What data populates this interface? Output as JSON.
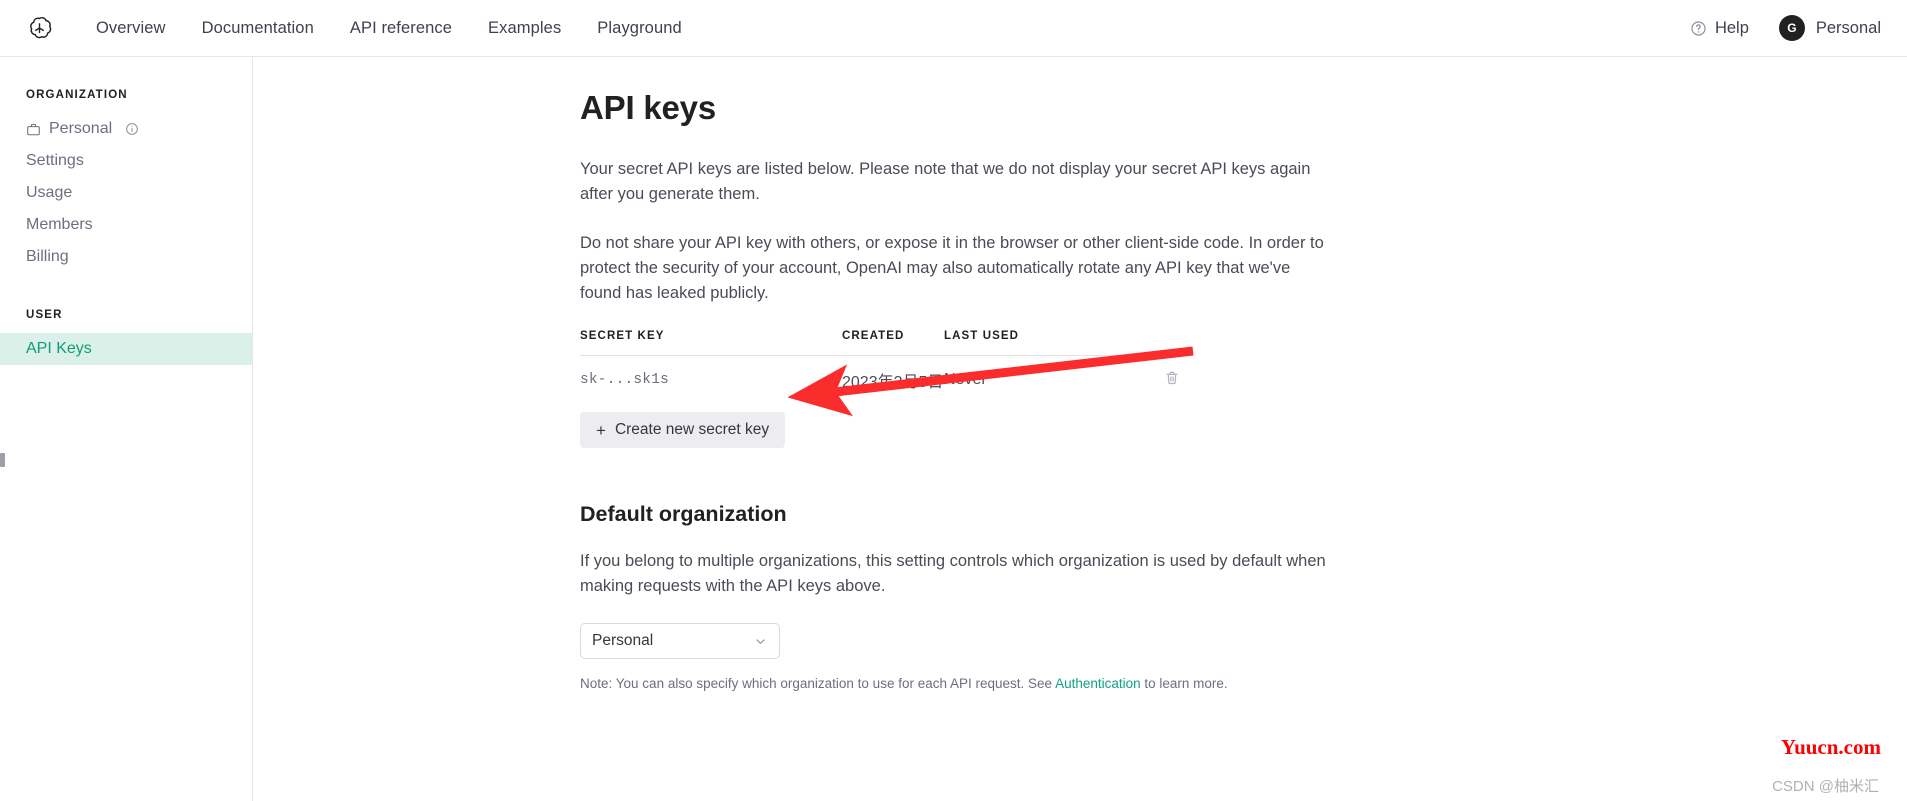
{
  "header": {
    "logo_icon": "openai-logo-icon",
    "nav": [
      {
        "label": "Overview"
      },
      {
        "label": "Documentation"
      },
      {
        "label": "API reference"
      },
      {
        "label": "Examples"
      },
      {
        "label": "Playground"
      }
    ],
    "help_label": "Help",
    "help_icon": "question-circle-icon",
    "account_label": "Personal",
    "avatar_initial": "G"
  },
  "sidebar": {
    "org_heading": "ORGANIZATION",
    "org_items": [
      {
        "label": "Personal",
        "icon": "briefcase-icon",
        "trailing_icon": "info-circle-icon",
        "active": false
      },
      {
        "label": "Settings",
        "icon": "",
        "active": false
      },
      {
        "label": "Usage",
        "icon": "",
        "active": false
      },
      {
        "label": "Members",
        "icon": "",
        "active": false
      },
      {
        "label": "Billing",
        "icon": "",
        "active": false
      }
    ],
    "user_heading": "USER",
    "user_items": [
      {
        "label": "API Keys",
        "active": true
      }
    ],
    "active_color": "#0f9d77",
    "active_bg": "#dbf0e9"
  },
  "main": {
    "title": "API keys",
    "paragraph1": "Your secret API keys are listed below. Please note that we do not display your secret API keys again after you generate them.",
    "paragraph2": "Do not share your API key with others, or expose it in the browser or other client-side code. In order to protect the security of your account, OpenAI may also automatically rotate any API key that we've found has leaked publicly.",
    "table": {
      "columns": [
        "SECRET KEY",
        "CREATED",
        "LAST USED",
        ""
      ],
      "rows": [
        {
          "secret_key": "sk-...sk1s",
          "created": "2023年3月5日",
          "last_used": "Never",
          "delete_icon": "trash-icon"
        }
      ]
    },
    "create_button": {
      "label": "Create new secret key",
      "icon": "plus-icon"
    },
    "default_org": {
      "title": "Default organization",
      "description": "If you belong to multiple organizations, this setting controls which organization is used by default when making requests with the API keys above.",
      "select_value": "Personal",
      "select_icon": "chevron-down-icon",
      "note_before": "Note: You can also specify which organization to use for each API request. See ",
      "note_link": "Authentication",
      "note_after": " to learn more.",
      "link_color": "#10a37f"
    }
  },
  "annotation": {
    "arrow_icon": "red-arrow-icon",
    "arrow_color": "#fb2c2c"
  },
  "watermarks": {
    "site": "Yuucn.com",
    "site_color": "#ff0000",
    "author": "CSDN @柚米汇"
  }
}
